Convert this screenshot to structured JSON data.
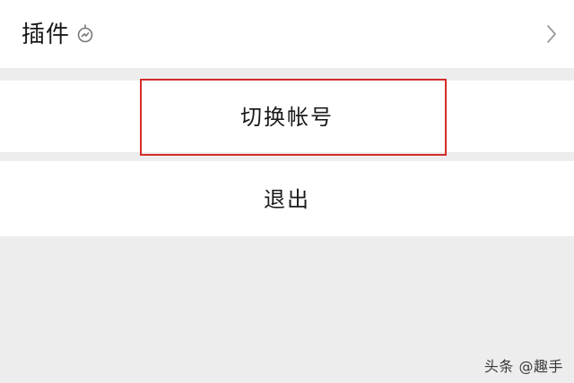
{
  "plugins_row": {
    "label": "插件",
    "icon": "gauge-icon",
    "chevron": "chevron-right-icon"
  },
  "switch_row": {
    "label": "切换帐号"
  },
  "logout_row": {
    "label": "退出"
  },
  "highlight": {
    "color": "#d42b2b"
  },
  "watermark": {
    "text": "头条 @趣手"
  }
}
